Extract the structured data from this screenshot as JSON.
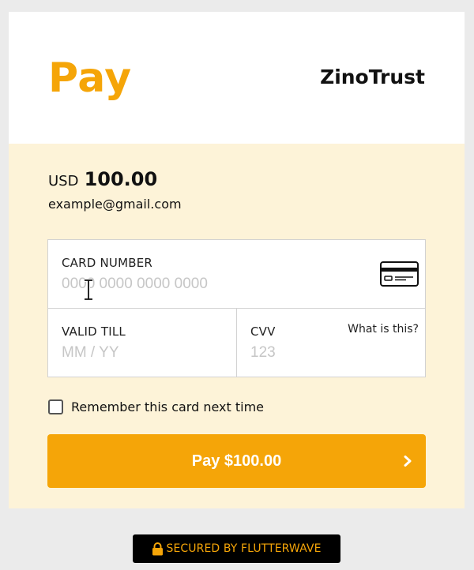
{
  "header": {
    "title": "Pay",
    "merchant": "ZinoTrust"
  },
  "summary": {
    "currency": "USD",
    "amount": "100.00",
    "email": "example@gmail.com"
  },
  "form": {
    "card_number": {
      "label": "CARD NUMBER",
      "placeholder": "0000 0000 0000 0000",
      "value": ""
    },
    "valid_till": {
      "label": "VALID TILL",
      "placeholder": "MM / YY",
      "value": ""
    },
    "cvv": {
      "label": "CVV",
      "placeholder": "123",
      "value": "",
      "help_link": "What is this?"
    }
  },
  "remember": {
    "label": "Remember this card next time",
    "checked": false
  },
  "pay_button": {
    "label": "Pay $100.00"
  },
  "footer": {
    "badge_text": "SECURED BY FLUTTERWAVE"
  },
  "icons": {
    "card": "credit-card-icon",
    "chevron": "chevron-right-icon",
    "lock": "lock-icon",
    "cursor": "text-cursor-icon"
  },
  "colors": {
    "accent": "#f5a508",
    "panel_background": "#fdf3d8",
    "page_background": "#ebebeb",
    "badge_background": "#000000"
  }
}
